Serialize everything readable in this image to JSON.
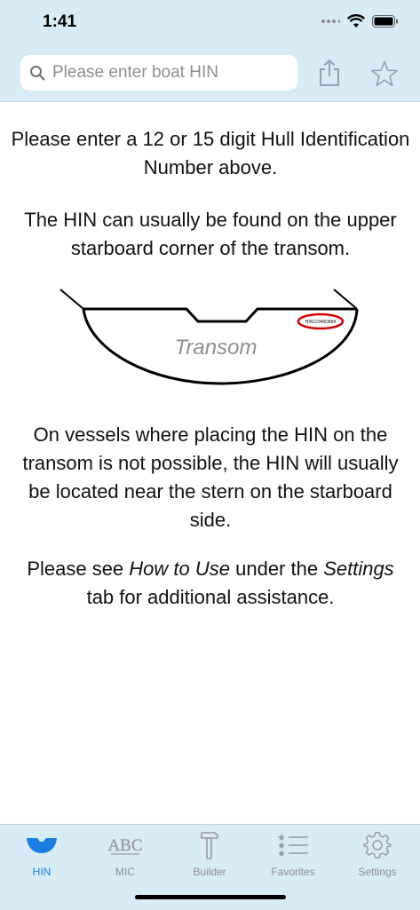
{
  "status_bar": {
    "time": "1:41"
  },
  "search": {
    "placeholder": "Please enter boat HIN",
    "value": ""
  },
  "icons": {
    "search": "magnifier-icon",
    "share": "share-icon",
    "favorite": "star-icon"
  },
  "content": {
    "para1": "Please enter a 12 or 15 digit Hull Identification Number above.",
    "para2": "The HIN can usually be found on the upper starboard corner of the transom.",
    "diagram": {
      "label": "Transom",
      "plate_text": "HIN12345D899"
    },
    "para3": "On vessels where placing the HIN on the transom is not possible, the HIN will usually be located near the stern on the starboard side.",
    "para4": {
      "t1": "Please see ",
      "em1": "How to Use",
      "t2": " under the ",
      "em2": "Settings",
      "t3": " tab for additional assistance."
    }
  },
  "tabs": [
    {
      "label": "HIN",
      "icon": "boat-hull-icon",
      "active": true
    },
    {
      "label": "MIC",
      "icon": "abc-text-icon",
      "active": false
    },
    {
      "label": "Builder",
      "icon": "hammer-icon",
      "active": false
    },
    {
      "label": "Favorites",
      "icon": "star-list-icon",
      "active": false
    },
    {
      "label": "Settings",
      "icon": "gear-icon",
      "active": false
    }
  ],
  "colors": {
    "bar_background": "#d7ecf7",
    "accent": "#1a7de0",
    "inactive": "#8e8e93",
    "plate_highlight": "#d40000"
  }
}
